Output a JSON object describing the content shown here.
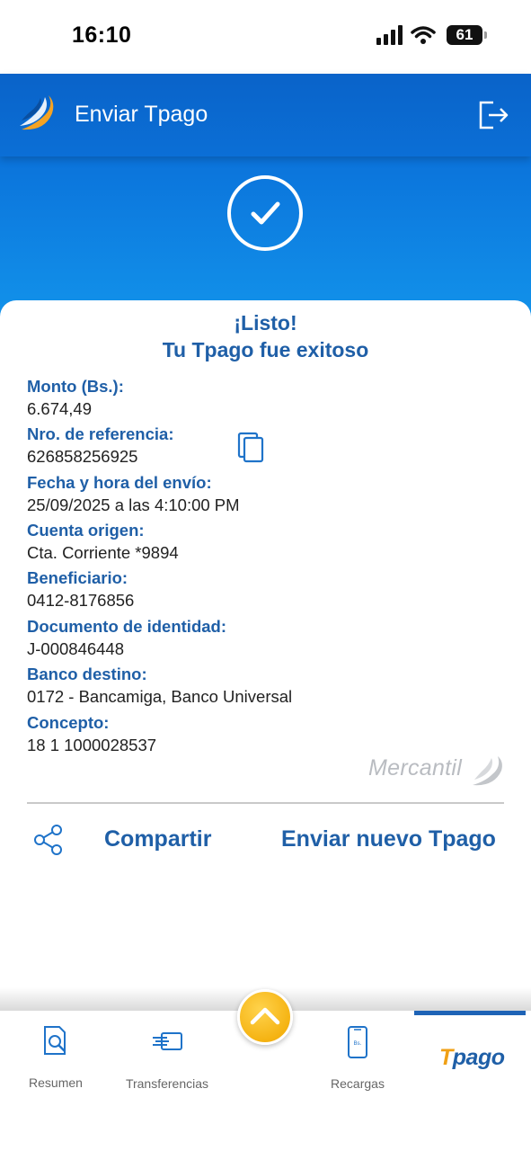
{
  "status_bar": {
    "time": "16:10",
    "battery": "61"
  },
  "header": {
    "title": "Enviar Tpago"
  },
  "card": {
    "title_line1": "¡Listo!",
    "title_line2": "Tu Tpago fue exitoso",
    "fields": [
      {
        "label": "Monto (Bs.):",
        "value": "6.674,49"
      },
      {
        "label": "Nro. de referencia:",
        "value": "626858256925"
      },
      {
        "label": "Fecha y hora del envío:",
        "value": "25/09/2025 a las 4:10:00 PM"
      },
      {
        "label": "Cuenta origen:",
        "value": "Cta. Corriente *9894"
      },
      {
        "label": "Beneficiario:",
        "value": "0412-8176856"
      },
      {
        "label": "Documento de identidad:",
        "value": "J-000846448"
      },
      {
        "label": "Banco destino:",
        "value": "0172 - Bancamiga, Banco Universal"
      },
      {
        "label": "Concepto:",
        "value": "18 1 1000028537"
      }
    ],
    "brand": "Mercantil"
  },
  "actions": {
    "share_label": "Compartir",
    "new_label": "Enviar nuevo Tpago"
  },
  "nav": {
    "items": [
      {
        "label": "Resumen",
        "icon": "document-search-icon"
      },
      {
        "label": "Transferencias",
        "icon": "transfer-icon"
      },
      {
        "label": "Recargas",
        "icon": "phone-recharge-icon"
      }
    ],
    "tpago_t": "T",
    "tpago_rest": "pago",
    "active": "Tpago"
  },
  "colors": {
    "primary": "#1f5fa7",
    "header": "#0a63c9",
    "accent": "#f5b312"
  }
}
